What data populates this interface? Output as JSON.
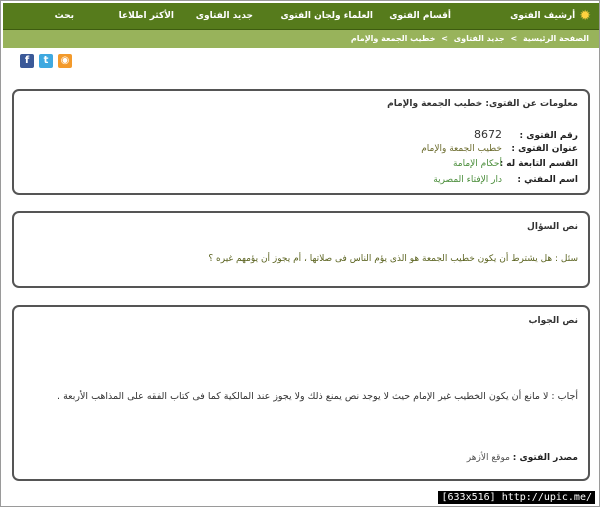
{
  "nav": {
    "brand": "أرشيف الفتوى",
    "sections": "أقسام الفتوى",
    "scholars": "العلماء ولجان الفتوى",
    "new": "جديد الفتاوى",
    "popular": "الأكثر اطلاعا",
    "search": "بحث"
  },
  "breadcrumb": {
    "home": "الصفحة الرئيسية",
    "separator": ">",
    "new": "جديد الفتاوى",
    "current": "خطيب الجمعة والإمام"
  },
  "social": {
    "facebook": "f",
    "twitter": "t",
    "rss": "◉"
  },
  "info": {
    "title": "معلومات عن الفتوى: خطيب الجمعة والإمام",
    "number_label": "رقم الفتوى :",
    "number_value": "8672",
    "title_label": "عنوان الفتوى :",
    "title_value": "خطيب الجمعة والإمام",
    "section_label": "القسم التابعة له :",
    "section_value": "أحكام الإمامة",
    "mufti_label": "اسم المفتي :",
    "mufti_value": "دار الإفتاء المصرية"
  },
  "question": {
    "title": "نص السؤال",
    "text": "سئل : هل يشترط أن يكون خطيب الجمعة هو الذى يؤم الناس فى صلاتها ، أم يجوز أن يؤمهم غيره ؟"
  },
  "answer": {
    "title": "نص الجواب",
    "text": "أجاب : لا مانع أن يكون الخطيب غير الإمام حيث لا يوجد نص يمنع ذلك ولا يجوز عند المالكية كما فى كتاب الفقه على المذاهب الأربعة .",
    "source_label": "مصدر الفتوى :",
    "source_value": "موقع الأزهر"
  },
  "watermark": "[633x516] http://upic.me/",
  "colors": {
    "nav_bg": "#567b1c",
    "breadcrumb_bg": "#98b35b",
    "link_green": "#4a8d3a"
  }
}
